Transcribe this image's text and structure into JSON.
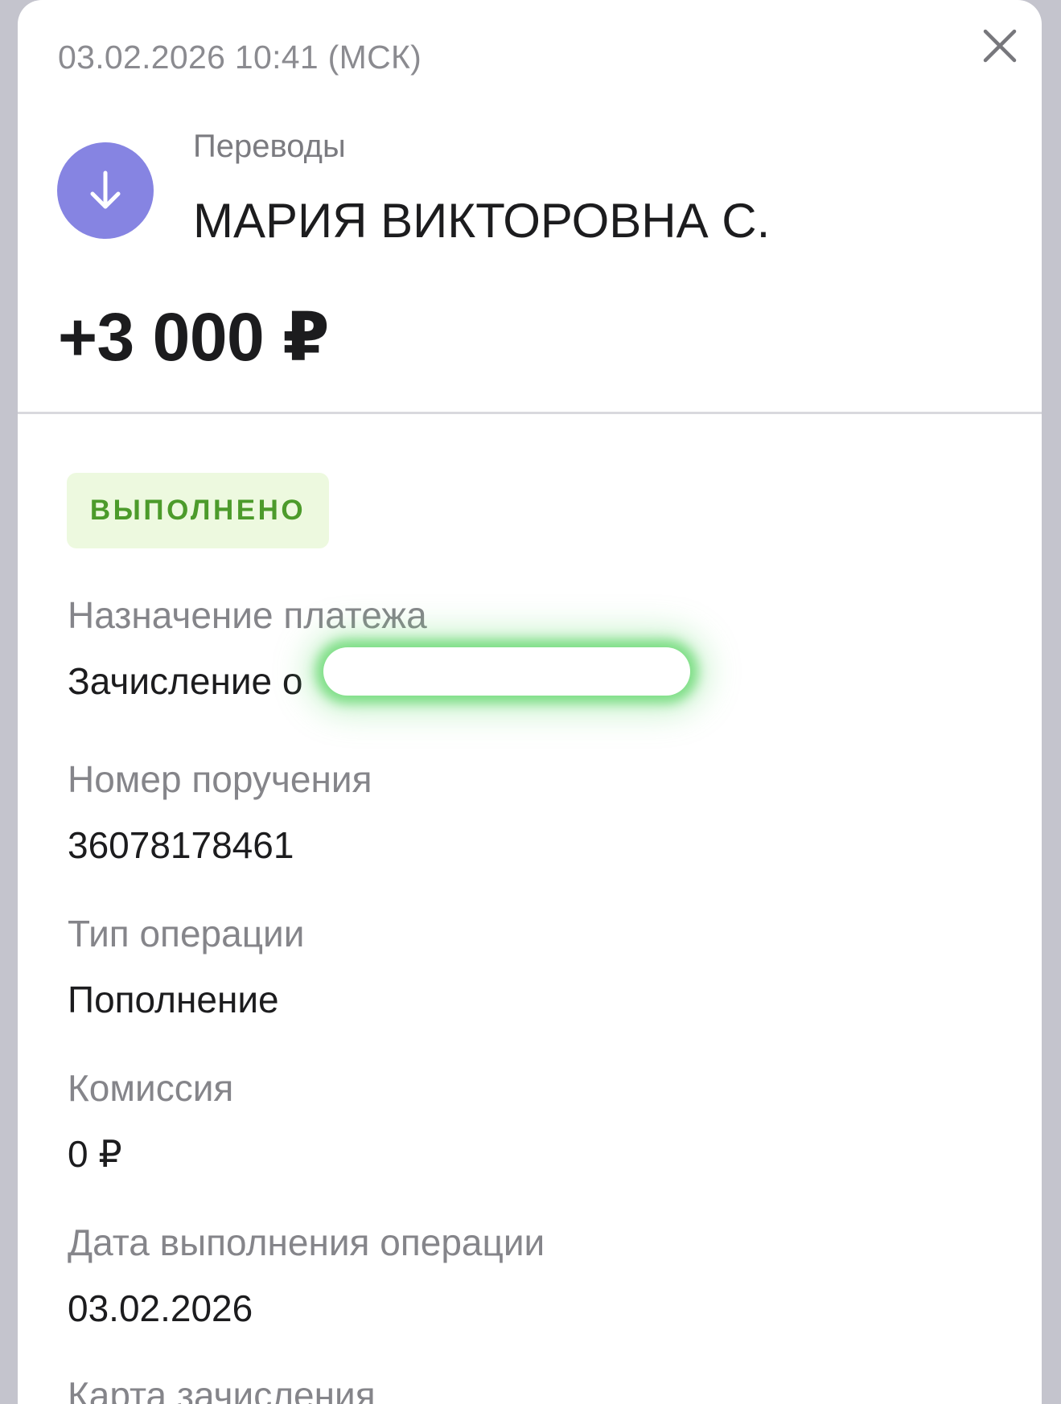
{
  "header": {
    "timestamp": "03.02.2026 10:41 (МСК)",
    "close_icon": "close-icon"
  },
  "operation": {
    "icon": "arrow-down-icon",
    "icon_color": "#8684e2",
    "category": "Переводы",
    "counterparty": "МАРИЯ ВИКТОРОВНА С.",
    "amount": "+3 000 ₽"
  },
  "status": {
    "label": "ВЫПОЛНЕНО",
    "color": "#4c9b2b",
    "background": "#edf9df"
  },
  "details": {
    "purpose_label": "Назначение платежа",
    "purpose_value": "Зачисление о",
    "order_number_label": "Номер поручения",
    "order_number_value": "36078178461",
    "operation_type_label": "Тип операции",
    "operation_type_value": "Пополнение",
    "fee_label": "Комиссия",
    "fee_value": "0 ₽",
    "execution_date_label": "Дата выполнения операции",
    "execution_date_value": "03.02.2026",
    "card_label": "Карта зачисления"
  }
}
